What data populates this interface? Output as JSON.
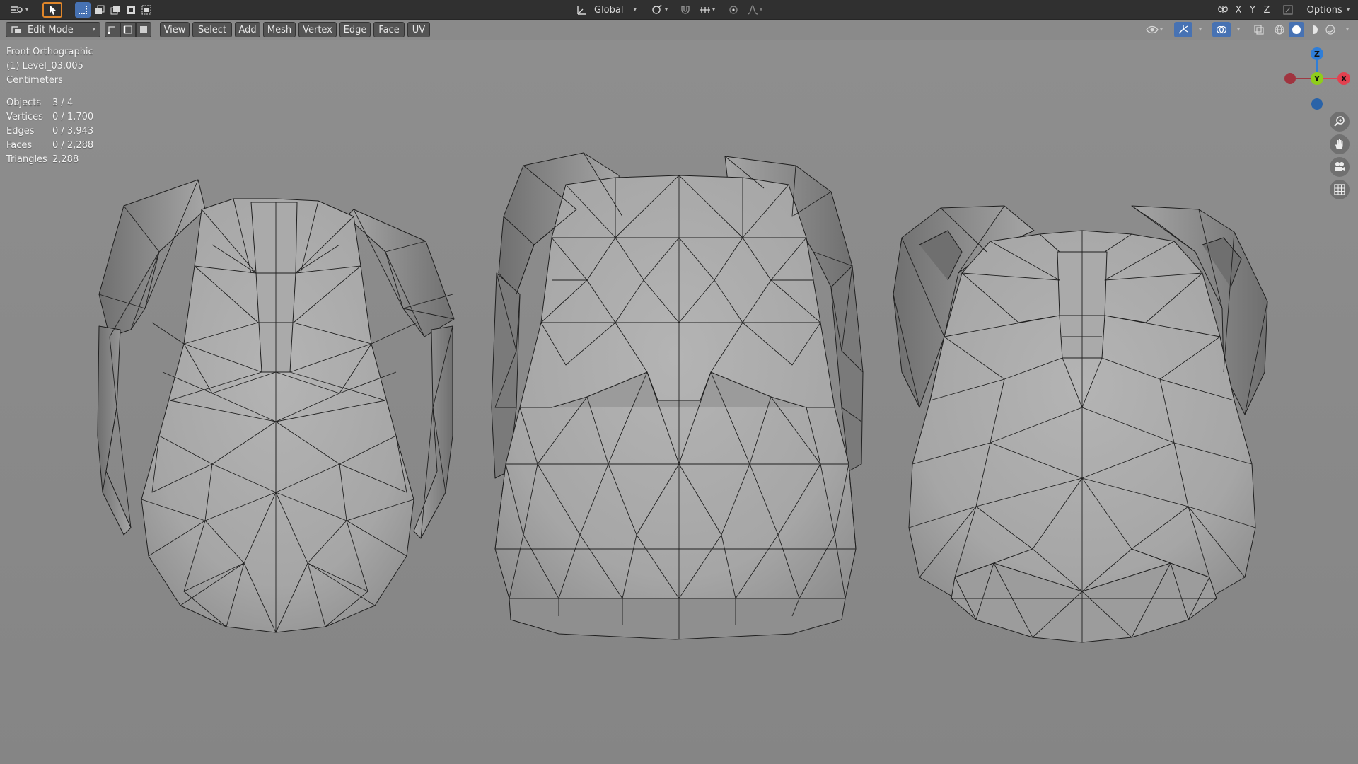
{
  "header": {
    "transform_orientation": "Global",
    "axis_x": "X",
    "axis_y": "Y",
    "axis_z": "Z",
    "options_label": "Options"
  },
  "menu": {
    "mode_label": "Edit Mode",
    "items": [
      "View",
      "Select",
      "Add",
      "Mesh",
      "Vertex",
      "Edge",
      "Face",
      "UV"
    ]
  },
  "viewport": {
    "view_name": "Front Orthographic",
    "object_name": "(1) Level_03.005",
    "units": "Centimeters",
    "stats": [
      {
        "label": "Objects",
        "value": "3 / 4"
      },
      {
        "label": "Vertices",
        "value": "0 / 1,700"
      },
      {
        "label": "Edges",
        "value": "0 / 3,943"
      },
      {
        "label": "Faces",
        "value": "0 / 2,288"
      },
      {
        "label": "Triangles",
        "value": "2,288"
      }
    ]
  },
  "gizmo": {
    "z_label": "Z",
    "y_label": "Y",
    "x_label": "X",
    "x_color": "#e2414f",
    "y_color": "#8fcd1b",
    "z_color": "#2f7ed8"
  },
  "colors": {
    "header_bg": "#303030",
    "viewport_bg": "#8a8a8a",
    "accent_blue": "#4772b3",
    "select_orange": "#e0862a",
    "mesh_fill": "#a9a9a9",
    "wire": "#1f1f1f"
  }
}
